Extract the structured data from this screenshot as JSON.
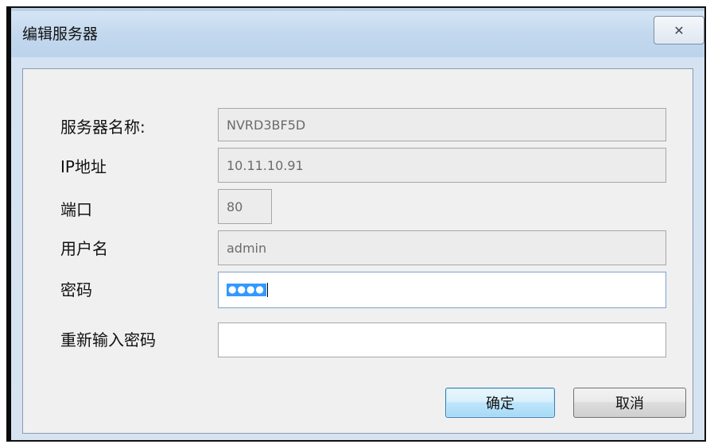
{
  "window": {
    "title": "编辑服务器",
    "close_icon_glyph": "✕"
  },
  "form": {
    "server_name": {
      "label": "服务器名称:",
      "value": "NVRD3BF5D"
    },
    "ip": {
      "label": "IP地址",
      "value": "10.11.10.91"
    },
    "port": {
      "label": "端口",
      "value": "80"
    },
    "username": {
      "label": "用户名",
      "value": "admin"
    },
    "password": {
      "label": "密码",
      "value": "●●●●"
    },
    "confirm_password": {
      "label": "重新输入密码",
      "value": ""
    }
  },
  "buttons": {
    "ok": "确定",
    "cancel": "取消"
  },
  "colors": {
    "selection": "#3399ff",
    "default_button": "#bee6fd",
    "title_bar": "#c3d8ee"
  }
}
